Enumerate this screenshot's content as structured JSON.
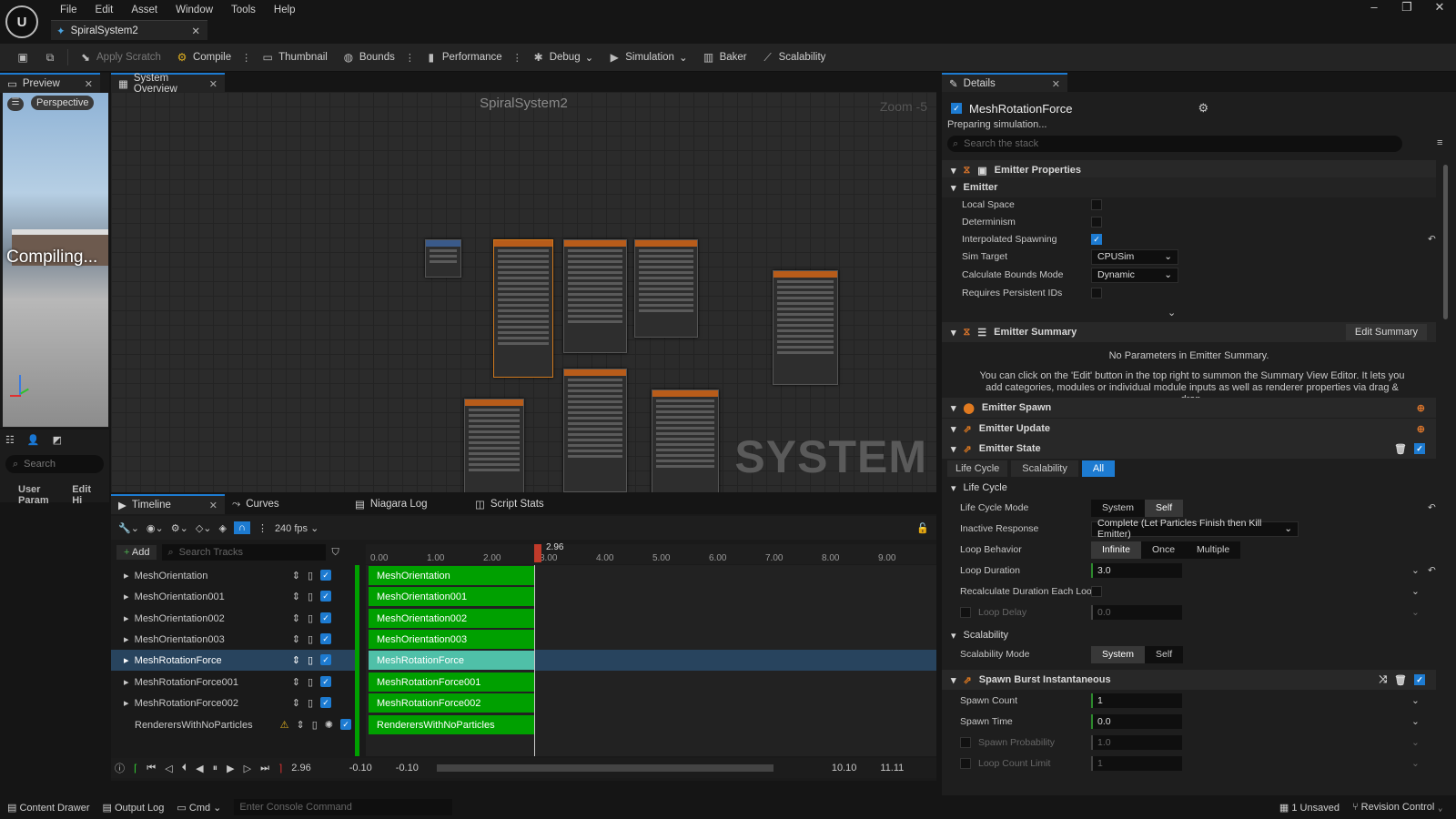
{
  "menu": [
    "File",
    "Edit",
    "Asset",
    "Window",
    "Tools",
    "Help"
  ],
  "doc_tab": "SpiralSystem2",
  "toolbar": {
    "apply_scratch": "Apply Scratch",
    "compile": "Compile",
    "thumbnail": "Thumbnail",
    "bounds": "Bounds",
    "performance": "Performance",
    "debug": "Debug",
    "simulation": "Simulation",
    "baker": "Baker",
    "scalability": "Scalability"
  },
  "preview": {
    "tab": "Preview",
    "perspective": "Perspective",
    "compiling": "Compiling...",
    "search_placeholder": "Search",
    "user_params": "User Param",
    "edit_hi": "Edit Hi"
  },
  "system_overview": {
    "tab": "System Overview",
    "title": "SpiralSystem2",
    "zoom": "Zoom -5",
    "watermark": "SYSTEM"
  },
  "timeline": {
    "tabs": [
      "Timeline",
      "Curves",
      "Niagara Log",
      "Script Stats"
    ],
    "fps": "240 fps",
    "add": "Add",
    "search_placeholder": "Search Tracks",
    "playhead": "2.96",
    "ticks": [
      "0.00",
      "1.00",
      "2.00",
      "3.00",
      "4.00",
      "5.00",
      "6.00",
      "7.00",
      "8.00",
      "9.00"
    ],
    "tracks": [
      "MeshOrientation",
      "MeshOrientation001",
      "MeshOrientation002",
      "MeshOrientation003",
      "MeshRotationForce",
      "MeshRotationForce001",
      "MeshRotationForce002",
      "RenderersWithNoParticles"
    ],
    "bottom": {
      "time": "2.96",
      "range_start_a": "-0.10",
      "range_start_b": "-0.10",
      "range_end_a": "10.10",
      "range_end_b": "11.11"
    }
  },
  "details": {
    "tab": "Details",
    "emitter_name": "MeshRotationForce",
    "status": "Preparing simulation...",
    "search_placeholder": "Search the stack",
    "emitter_properties": "Emitter Properties",
    "emitter": "Emitter",
    "props": {
      "local_space": "Local Space",
      "determinism": "Determinism",
      "interp_spawning": "Interpolated Spawning",
      "sim_target": "Sim Target",
      "sim_target_val": "CPUSim",
      "calc_bounds": "Calculate Bounds Mode",
      "calc_bounds_val": "Dynamic",
      "persistent_ids": "Requires Persistent IDs"
    },
    "emitter_summary": "Emitter Summary",
    "edit_summary": "Edit Summary",
    "no_params": "No Parameters in Emitter Summary.",
    "summary_help": "You can click on the 'Edit' button in the top right to summon the Summary View Editor. It lets you add categories, modules or individual module inputs as well as renderer properties via drag & drop.",
    "emitter_spawn": "Emitter Spawn",
    "emitter_update": "Emitter Update",
    "emitter_state": "Emitter State",
    "state_tabs": [
      "Life Cycle",
      "Scalability",
      "All"
    ],
    "life_cycle": "Life Cycle",
    "lcm": "Life Cycle Mode",
    "lcm_opts": [
      "System",
      "Self"
    ],
    "inactive": "Inactive Response",
    "inactive_val": "Complete (Let Particles Finish then Kill Emitter)",
    "loop_behavior": "Loop Behavior",
    "loop_opts": [
      "Infinite",
      "Once",
      "Multiple"
    ],
    "loop_duration": "Loop Duration",
    "loop_duration_val": "3.0",
    "recalc": "Recalculate Duration Each Loop",
    "loop_delay": "Loop Delay",
    "loop_delay_val": "0.0",
    "scalability": "Scalability",
    "scal_mode": "Scalability Mode",
    "scal_opts": [
      "System",
      "Self"
    ],
    "spawn_burst": "Spawn Burst Instantaneous",
    "spawn_count": "Spawn Count",
    "spawn_count_val": "1",
    "spawn_time": "Spawn Time",
    "spawn_time_val": "0.0",
    "spawn_prob": "Spawn Probability",
    "spawn_prob_val": "1.0",
    "loop_count_limit": "Loop Count Limit",
    "loop_count_limit_val": "1"
  },
  "statusbar": {
    "content_drawer": "Content Drawer",
    "output_log": "Output Log",
    "cmd": "Cmd",
    "console_placeholder": "Enter Console Command",
    "unsaved": "1 Unsaved",
    "revision": "Revision Control"
  }
}
